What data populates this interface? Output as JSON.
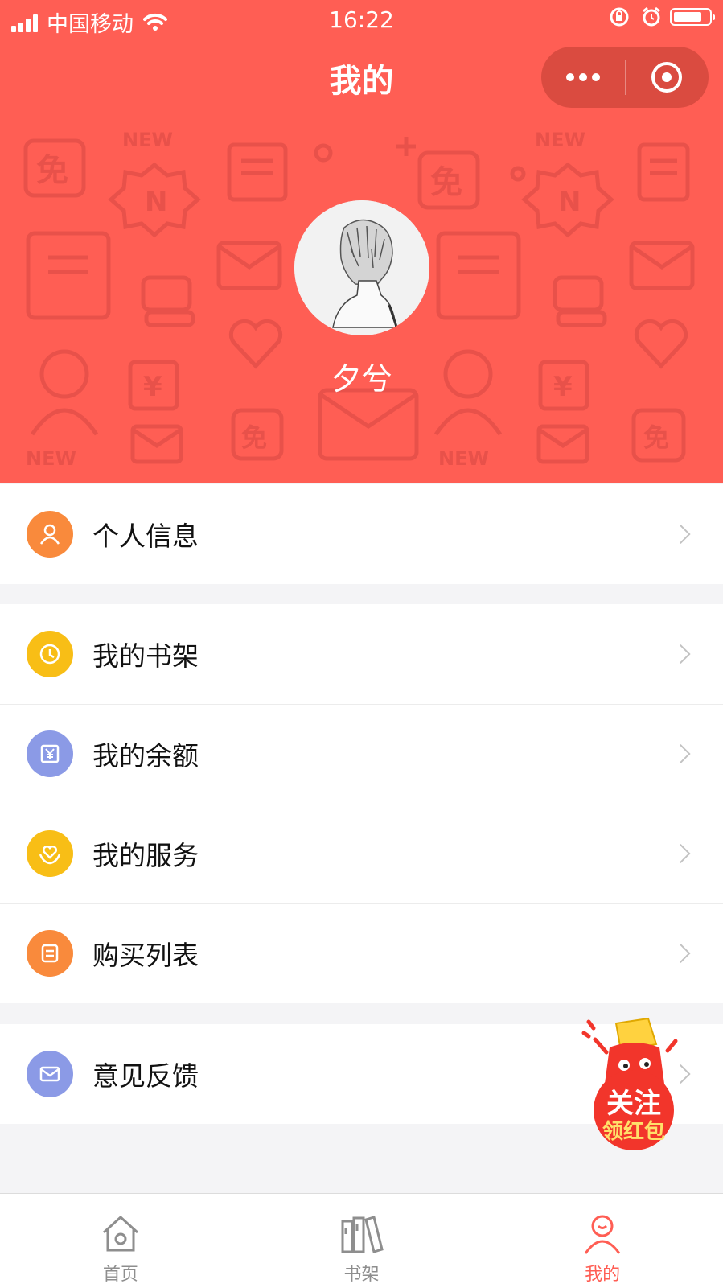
{
  "status_bar": {
    "carrier": "中国移动",
    "time": "16:22",
    "icons": [
      "signal-icon",
      "wifi-icon",
      "rotation-lock-icon",
      "alarm-icon",
      "battery-icon"
    ]
  },
  "header": {
    "title": "我的",
    "capsule": {
      "more_icon": "more-dots-icon",
      "close_icon": "target-circle-icon"
    },
    "pattern_words": [
      "NEW",
      "NEW",
      "NEW",
      "NEW"
    ],
    "pattern_glyphs": [
      "免",
      "N",
      "¥"
    ]
  },
  "profile": {
    "username": "夕兮",
    "avatar": "anime-avatar"
  },
  "menu": {
    "personal_info": {
      "label": "个人信息",
      "icon": "person-icon",
      "color": "#f98a3c"
    },
    "bookshelf": {
      "label": "我的书架",
      "icon": "clock-icon",
      "color": "#f8be16"
    },
    "balance": {
      "label": "我的余额",
      "icon": "yuan-icon",
      "color": "#8b9ae6"
    },
    "service": {
      "label": "我的服务",
      "icon": "heart-hands-icon",
      "color": "#f8be16"
    },
    "purchases": {
      "label": "购买列表",
      "icon": "list-icon",
      "color": "#f98a3c"
    },
    "feedback": {
      "label": "意见反馈",
      "icon": "mail-icon",
      "color": "#8b9ae6"
    }
  },
  "promo": {
    "line1": "关注",
    "line2": "领红包"
  },
  "tabbar": {
    "tabs": [
      {
        "label": "首页",
        "icon": "home-icon",
        "active": false
      },
      {
        "label": "书架",
        "icon": "books-icon",
        "active": false
      },
      {
        "label": "我的",
        "icon": "person-icon",
        "active": true
      }
    ]
  },
  "colors": {
    "brand_red": "#ff5e54",
    "background": "#f4f4f6",
    "text": "#111111",
    "tab_inactive": "#8e8e8e"
  }
}
